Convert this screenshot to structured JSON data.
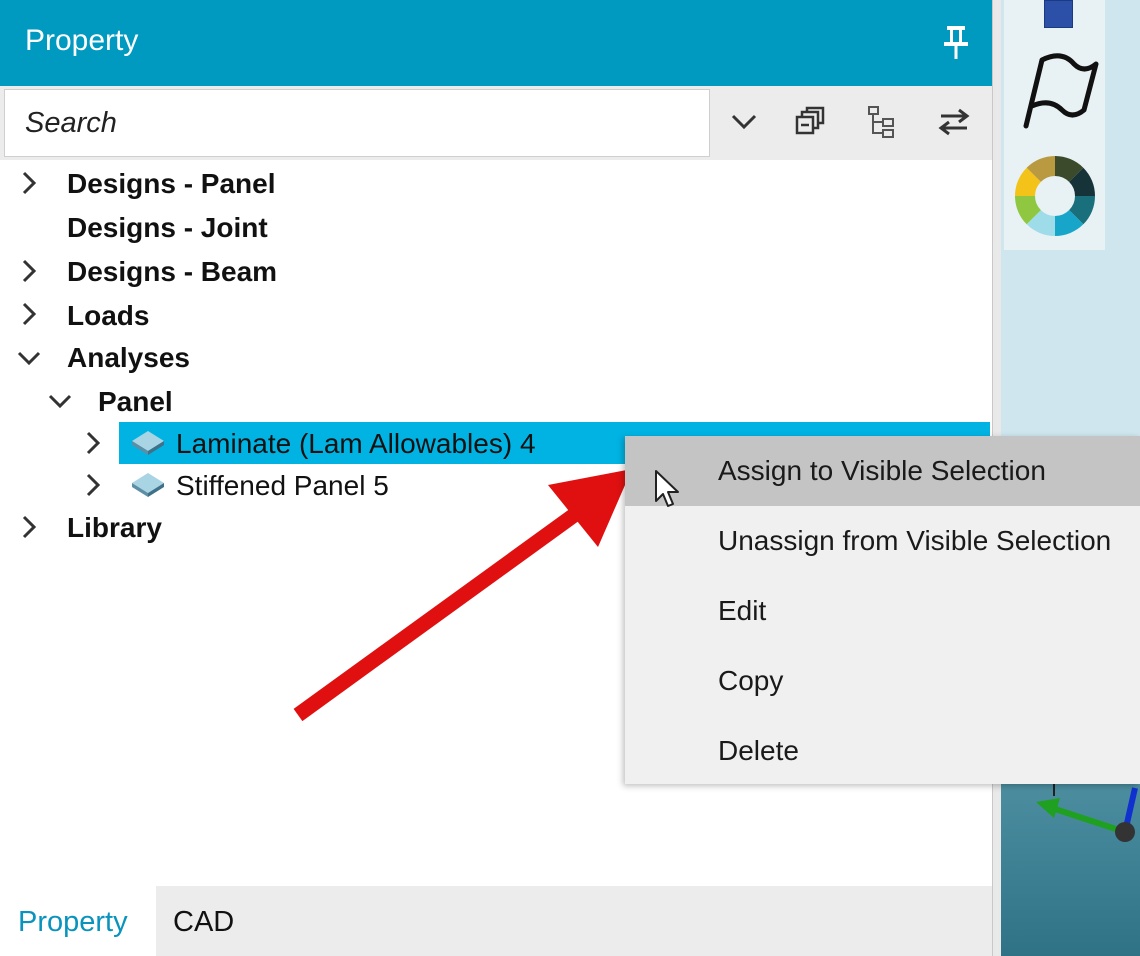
{
  "panel": {
    "title": "Property",
    "pin_icon": "pin-icon"
  },
  "search": {
    "placeholder": "Search",
    "toolbar_icons": [
      "chevron-down-icon",
      "collapse-all-icon",
      "tree-hierarchy-icon",
      "swap-arrows-icon"
    ]
  },
  "tree": {
    "items": [
      {
        "label": "Designs - Panel",
        "expanded": false,
        "has_children": true
      },
      {
        "label": "Designs - Joint",
        "expanded": false,
        "has_children": false
      },
      {
        "label": "Designs - Beam",
        "expanded": false,
        "has_children": true
      },
      {
        "label": "Loads",
        "expanded": false,
        "has_children": true
      },
      {
        "label": "Analyses",
        "expanded": true,
        "has_children": true
      },
      {
        "label": "Panel",
        "expanded": true,
        "has_children": true
      },
      {
        "label": "Laminate (Lam Allowables) 4",
        "selected": true,
        "icon": "laminate-icon"
      },
      {
        "label": "Stiffened Panel 5",
        "selected": false,
        "icon": "laminate-icon"
      },
      {
        "label": "Library",
        "expanded": false,
        "has_children": true
      }
    ]
  },
  "context_menu": {
    "items": [
      {
        "label": "Assign to Visible Selection",
        "hovered": true
      },
      {
        "label": "Unassign from Visible Selection"
      },
      {
        "label": "Edit"
      },
      {
        "label": "Copy"
      },
      {
        "label": "Delete"
      }
    ]
  },
  "tabs": [
    {
      "label": "Property",
      "active": true
    },
    {
      "label": "CAD",
      "active": false
    }
  ],
  "colors": {
    "accent": "#0099c0",
    "selection": "#00b3e3",
    "arrow": "#e01010",
    "menu_hover": "#c4c4c4"
  }
}
